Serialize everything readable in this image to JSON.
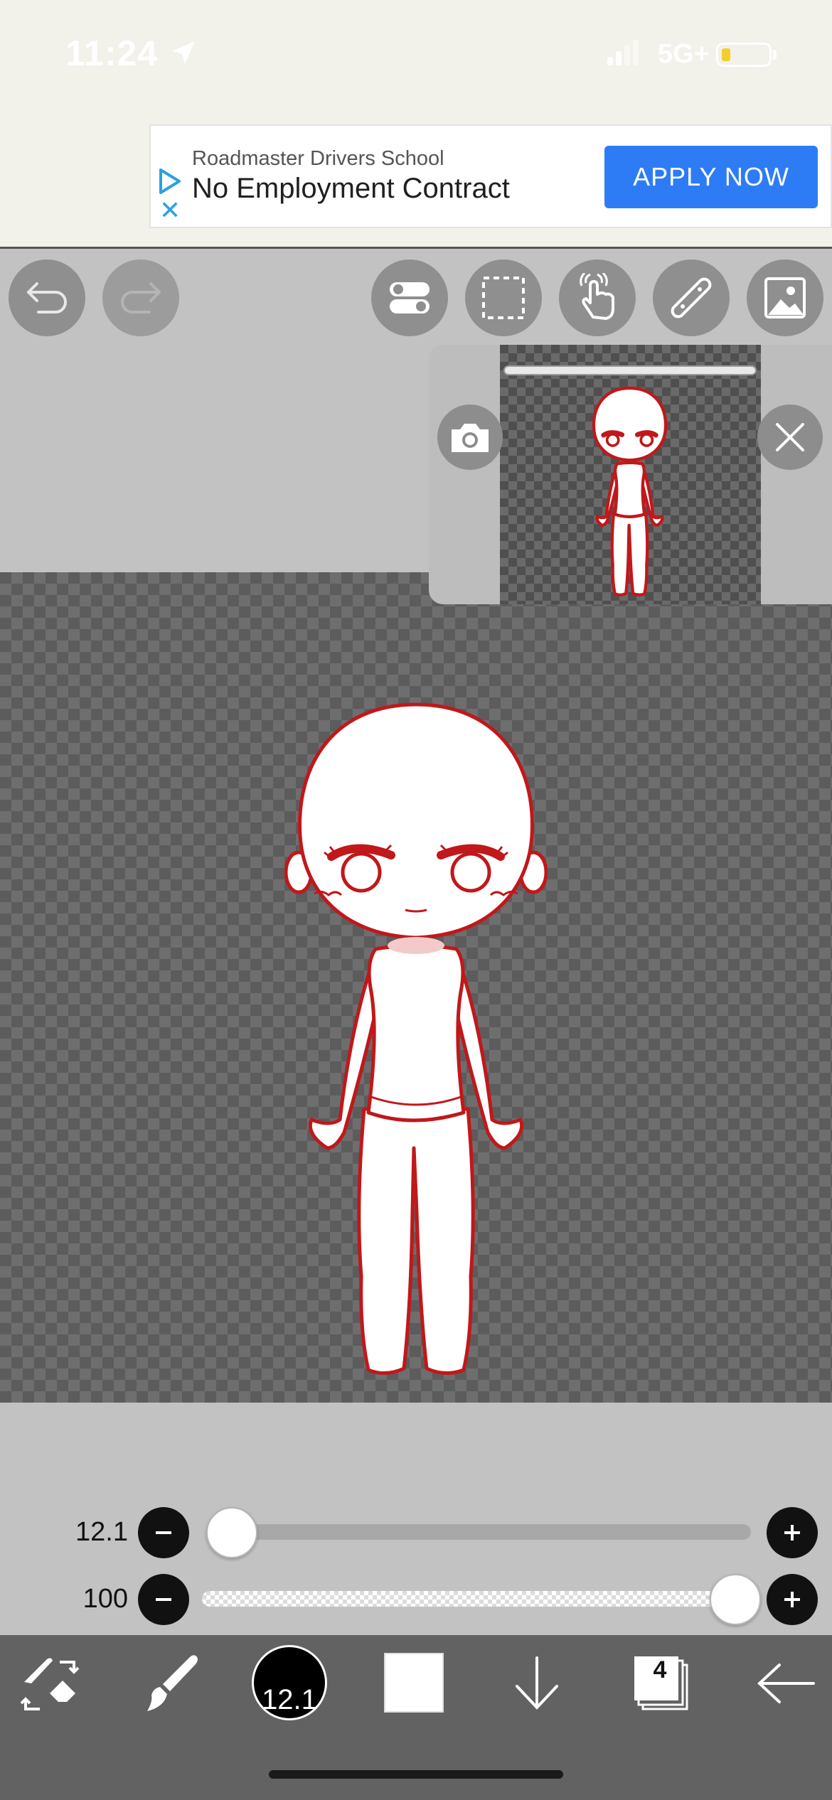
{
  "status_bar": {
    "time": "11:24",
    "network": "5G+"
  },
  "ad": {
    "sponsor": "Roadmaster Drivers School",
    "headline": "No Employment Contract",
    "cta": "APPLY NOW"
  },
  "toolbar": {
    "items": [
      "undo",
      "redo",
      "toggle",
      "selection",
      "touch",
      "ruler",
      "image"
    ]
  },
  "sliders": {
    "brush_size": {
      "label": "12.1",
      "level": 0.02
    },
    "opacity": {
      "label": "100",
      "level": 1.0
    }
  },
  "bottom_bar": {
    "brush_size": "12.1",
    "color": "#ffffff",
    "layers": "4"
  },
  "colors": {
    "accent": "#2d7cf6",
    "outline": "#c0181b"
  }
}
